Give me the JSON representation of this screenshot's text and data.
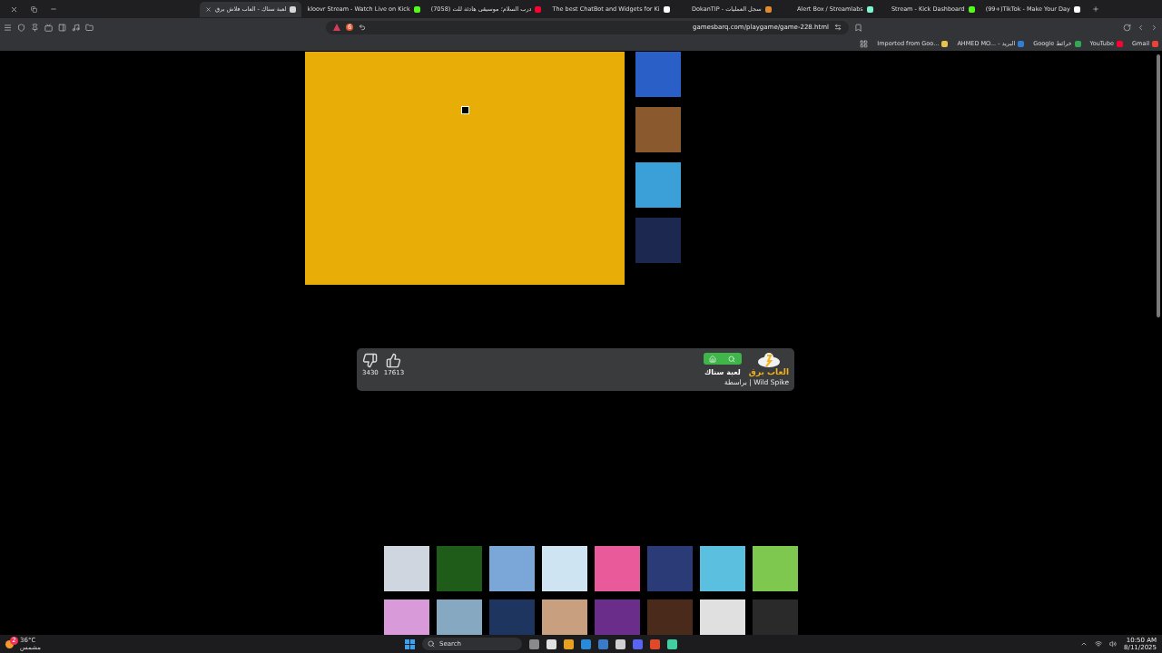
{
  "tabs": [
    {
      "title": "(99+)TikTok - Make Your Day",
      "selected": false,
      "color": "#ffffff"
    },
    {
      "title": "Stream - Kick Dashboard",
      "selected": false,
      "color": "#53fc18"
    },
    {
      "title": "Alert Box / Streamlabs",
      "selected": false,
      "color": "#80f5d2"
    },
    {
      "title": "DokanTIP - سجل العمليات",
      "selected": false,
      "color": "#e08a2c"
    },
    {
      "title": "The best ChatBot and Widgets for Ki",
      "selected": false,
      "color": "#ffffff"
    },
    {
      "title": "(7058) درب السلام؛ موسيقى هادئة للت",
      "selected": false,
      "color": "#ff0033"
    },
    {
      "title": "kloovr Stream - Watch Live on Kick",
      "selected": false,
      "color": "#53fc18"
    },
    {
      "title": "لعبة سناك - العاب فلاش برق",
      "selected": true,
      "color": "#d8d8d8"
    }
  ],
  "address": {
    "url": "gamesbarq.com/playgame/game-228.html",
    "shield_count": "6"
  },
  "bookmarks": [
    {
      "label": "Gmail",
      "color": "#ea4335"
    },
    {
      "label": "YouTube",
      "color": "#ff0033"
    },
    {
      "label": "Google خرائط",
      "color": "#34a853"
    },
    {
      "label": "AHMED MO... - البريد",
      "color": "#2f7fd6"
    },
    {
      "label": "Imported from Goo...",
      "color": "#e8c34a"
    }
  ],
  "game_panel": {
    "dislikes": "3430",
    "likes": "17613",
    "logo_text": "العاب برق",
    "title": "لعبة سناك",
    "byline": "براسطة | Wild Spike"
  },
  "taskbar": {
    "temperature": "36°C",
    "weather": "مشمس",
    "weather_badge": "2",
    "search": "Search",
    "time": "10:50 AM",
    "date": "8/11/2025"
  }
}
